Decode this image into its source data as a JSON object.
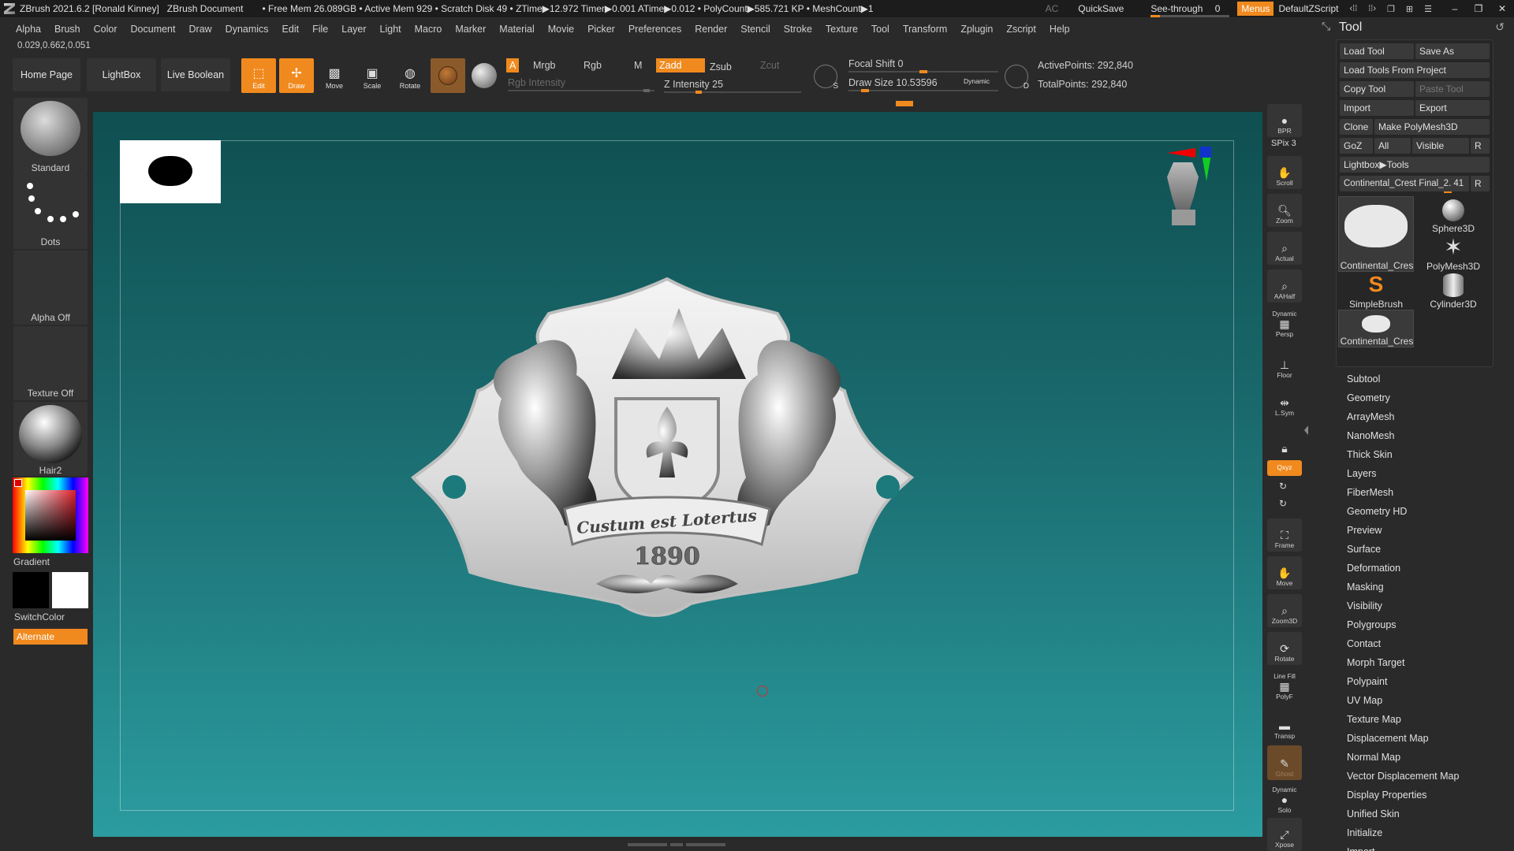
{
  "titlebar": {
    "app_title": "ZBrush 2021.6.2 [Ronald Kinney]",
    "document": "ZBrush Document",
    "stats": "• Free Mem 26.089GB • Active Mem 929 • Scratch Disk 49 • ZTime▶12.972 Timer▶0.001 ATime▶0.012 • PolyCount▶585.721 KP • MeshCount▶1",
    "ac": "AC",
    "quicksave": "QuickSave",
    "see_through": "See-through",
    "see_through_value": "0",
    "see_through_fraction": 0.12,
    "menus": "Menus",
    "layout": "DefaultZScript"
  },
  "menubar": [
    "Alpha",
    "Brush",
    "Color",
    "Document",
    "Draw",
    "Dynamics",
    "Edit",
    "File",
    "Layer",
    "Light",
    "Macro",
    "Marker",
    "Material",
    "Movie",
    "Picker",
    "Preferences",
    "Render",
    "Stencil",
    "Stroke",
    "Texture",
    "Tool",
    "Transform",
    "Zplugin",
    "Zscript",
    "Help"
  ],
  "coords": "0.029,0.662,0.051",
  "shelf": {
    "home_page": "Home Page",
    "lightbox": "LightBox",
    "live_boolean": "Live Boolean",
    "edit": "Edit",
    "draw": "Draw",
    "move": "Move",
    "scale": "Scale",
    "rotate": "Rotate",
    "a_tag": "A",
    "mrgb": "Mrgb",
    "rgb": "Rgb",
    "m": "M",
    "rgb_intensity": "Rgb Intensity",
    "zadd": "Zadd",
    "zsub": "Zsub",
    "zcut": "Zcut",
    "z_intensity": "Z Intensity 25",
    "z_intensity_fraction": 0.25,
    "focal_shift": "Focal Shift 0",
    "draw_size": "Draw Size 10.53596",
    "dynamic": "Dynamic",
    "s_label": "S",
    "d_label": "D",
    "active_points": "ActivePoints: 292,840",
    "total_points": "TotalPoints: 292,840"
  },
  "left": {
    "brush": "Standard",
    "stroke": "Dots",
    "alpha": "Alpha Off",
    "texture": "Texture Off",
    "material": "Hair2",
    "gradient": "Gradient",
    "switch_color": "SwitchColor",
    "alternate": "Alternate"
  },
  "canvas": {
    "emblem_text": "Custum est Lotertus",
    "emblem_year": "1890"
  },
  "righttoolbar": {
    "bpr": "BPR",
    "spix": "SPix 3",
    "scroll": "Scroll",
    "zoom": "Zoom",
    "actual": "Actual",
    "aahalf": "AAHalf",
    "dynamic": "Dynamic",
    "persp": "Persp",
    "floor": "Floor",
    "lsym": "L.Sym",
    "xyz": "Qxyz",
    "frame": "Frame",
    "move": "Move",
    "zoom3d": "Zoom3D",
    "rotate": "Rotate",
    "linefill": "Line Fill",
    "polyf": "PolyF",
    "transp": "Transp",
    "ghost": "Ghost",
    "dynamic2": "Dynamic",
    "solo": "Solo",
    "xpose": "Xpose"
  },
  "toolpanel": {
    "title": "Tool",
    "load_tool": "Load Tool",
    "save_as": "Save As",
    "load_from_project": "Load Tools From Project",
    "copy_tool": "Copy Tool",
    "paste_tool": "Paste Tool",
    "import": "Import",
    "export": "Export",
    "clone": "Clone",
    "make_polymesh": "Make PolyMesh3D",
    "goz": "GoZ",
    "all": "All",
    "visible": "Visible",
    "r": "R",
    "lightbox_tools": "Lightbox▶Tools",
    "current_tool": "Continental_Crest Final_2. 41",
    "thumbs": [
      {
        "label": "Continental_Cres",
        "icon": "crest-icon"
      },
      {
        "label": "Sphere3D",
        "icon": "sphere-icon"
      },
      {
        "label": "PolyMesh3D",
        "icon": "star-icon"
      },
      {
        "label": "SimpleBrush",
        "icon": "simplebrush-icon"
      },
      {
        "label": "Cylinder3D",
        "icon": "cylinder-icon"
      },
      {
        "label": "Continental_Cres",
        "icon": "crest-small-icon"
      }
    ],
    "sections": [
      "Subtool",
      "Geometry",
      "ArrayMesh",
      "NanoMesh",
      "Thick Skin",
      "Layers",
      "FiberMesh",
      "Geometry HD",
      "Preview",
      "Surface",
      "Deformation",
      "Masking",
      "Visibility",
      "Polygroups",
      "Contact",
      "Morph Target",
      "Polypaint",
      "UV Map",
      "Texture Map",
      "Displacement Map",
      "Normal Map",
      "Vector Displacement Map",
      "Display Properties",
      "Unified Skin",
      "Initialize",
      "Import"
    ]
  },
  "colors": {
    "accent": "#f08a1e",
    "canvas_top": "#0f4f51",
    "canvas_bottom": "#2b9ca0",
    "panel": "#2a2a2a"
  }
}
